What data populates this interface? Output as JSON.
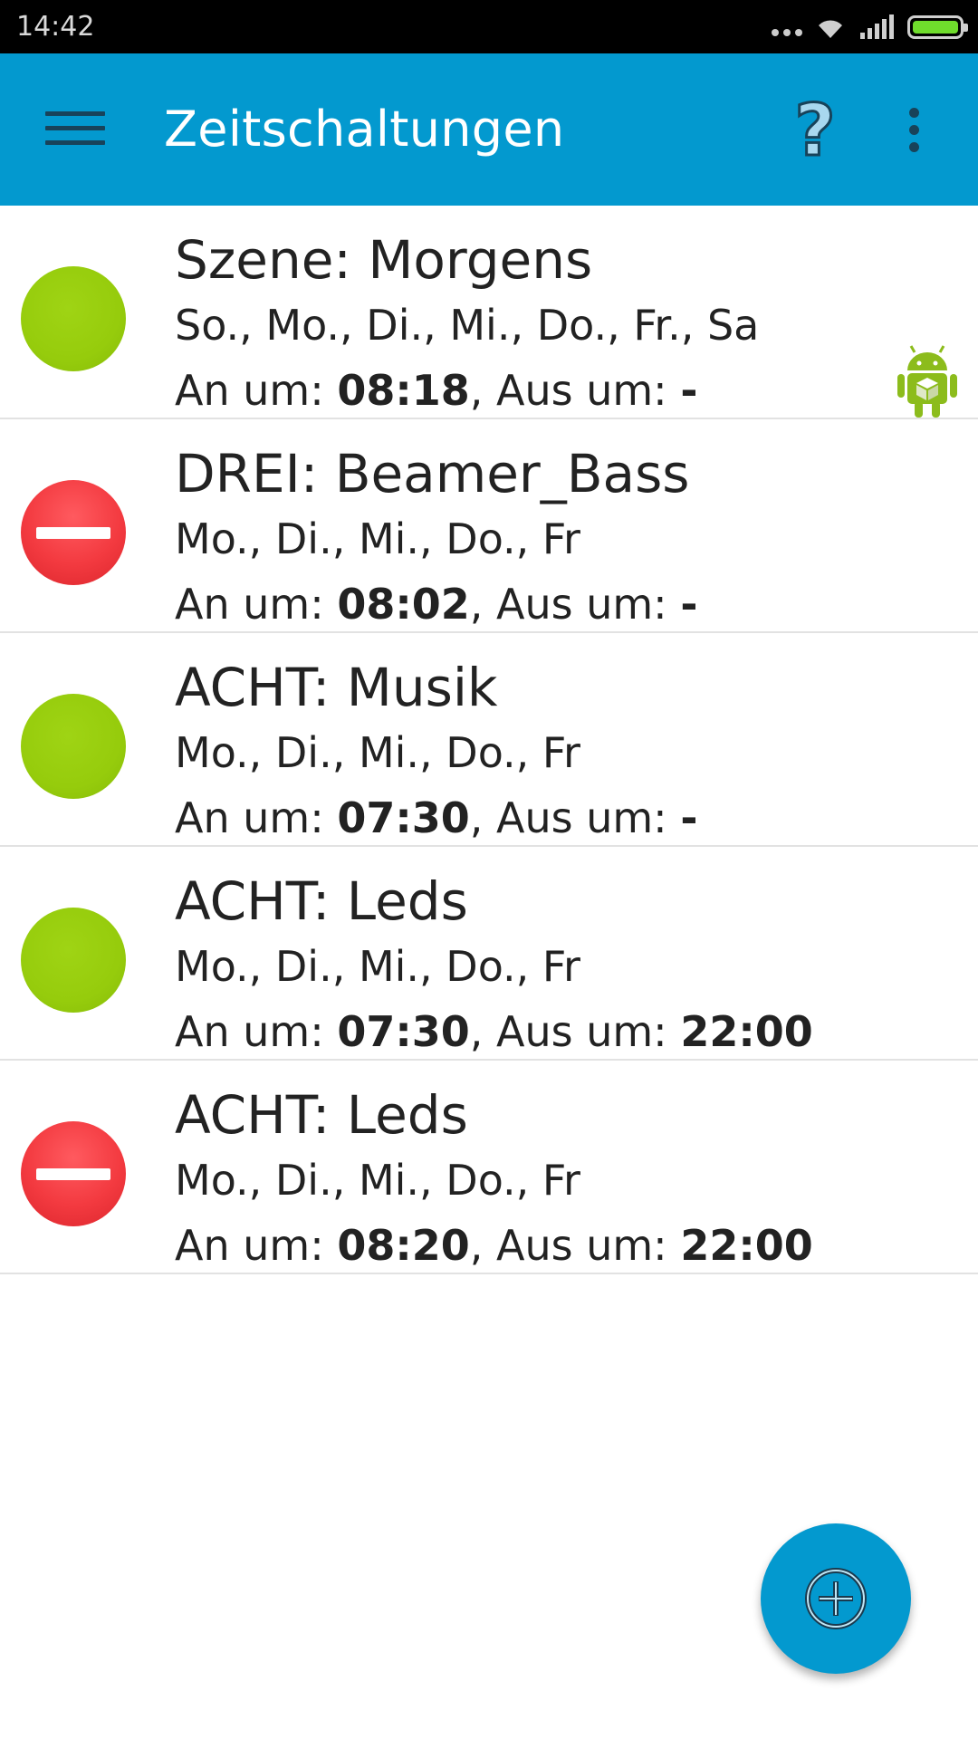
{
  "status_bar": {
    "time": "14:42"
  },
  "app_bar": {
    "title": "Zeitschaltungen",
    "help_label": "?"
  },
  "colors": {
    "app_bar": "#0399cf",
    "active": "#96cc0c",
    "inactive": "#f33a40"
  },
  "labels": {
    "on_at": "An um: ",
    "off_at": ", Aus um: "
  },
  "timers": [
    {
      "title": "Szene: Morgens",
      "days": "So., Mo., Di., Mi., Do., Fr., Sa",
      "on_time": "08:18",
      "off_time": "-",
      "state": "active",
      "badge": "android-icon"
    },
    {
      "title": "DREI: Beamer_Bass",
      "days": "Mo., Di., Mi., Do., Fr",
      "on_time": "08:02",
      "off_time": "-",
      "state": "inactive"
    },
    {
      "title": "ACHT: Musik",
      "days": "Mo., Di., Mi., Do., Fr",
      "on_time": "07:30",
      "off_time": "-",
      "state": "active"
    },
    {
      "title": "ACHT: Leds",
      "days": "Mo., Di., Mi., Do., Fr",
      "on_time": "07:30",
      "off_time": "22:00",
      "state": "active"
    },
    {
      "title": "ACHT: Leds",
      "days": "Mo., Di., Mi., Do., Fr",
      "on_time": "08:20",
      "off_time": "22:00",
      "state": "inactive"
    }
  ],
  "fab": {
    "icon": "add-circle-icon"
  }
}
